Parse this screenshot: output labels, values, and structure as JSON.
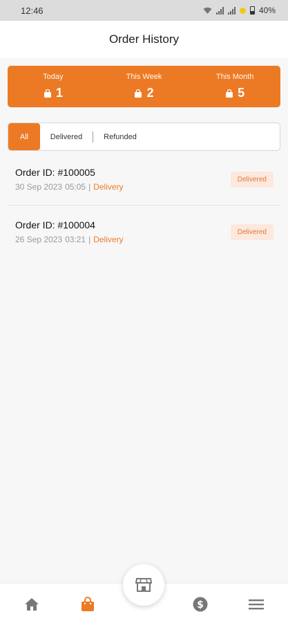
{
  "status_bar": {
    "time": "12:46",
    "battery": "40%"
  },
  "header": {
    "title": "Order History"
  },
  "summary": {
    "today_label": "Today",
    "today_count": "1",
    "week_label": "This Week",
    "week_count": "2",
    "month_label": "This Month",
    "month_count": "5"
  },
  "tabs": {
    "all": "All",
    "delivered": "Delivered",
    "refunded": "Refunded",
    "active": "All"
  },
  "orders": [
    {
      "id": "Order ID: #100005",
      "date": "30 Sep 2023",
      "time": "05:05",
      "separator": "|",
      "type": "Delivery",
      "status": "Delivered"
    },
    {
      "id": "Order ID: #100004",
      "date": "26 Sep 2023",
      "time": "03:21",
      "separator": "|",
      "type": "Delivery",
      "status": "Delivered"
    }
  ],
  "colors": {
    "accent": "#ec7a25",
    "badge_bg": "#fce8dc",
    "badge_text": "#e2773b"
  },
  "nav": {
    "items": [
      "home-icon",
      "shopping-bag-icon",
      "store-icon",
      "dollar-icon",
      "menu-icon"
    ],
    "active": "shopping-bag-icon"
  }
}
